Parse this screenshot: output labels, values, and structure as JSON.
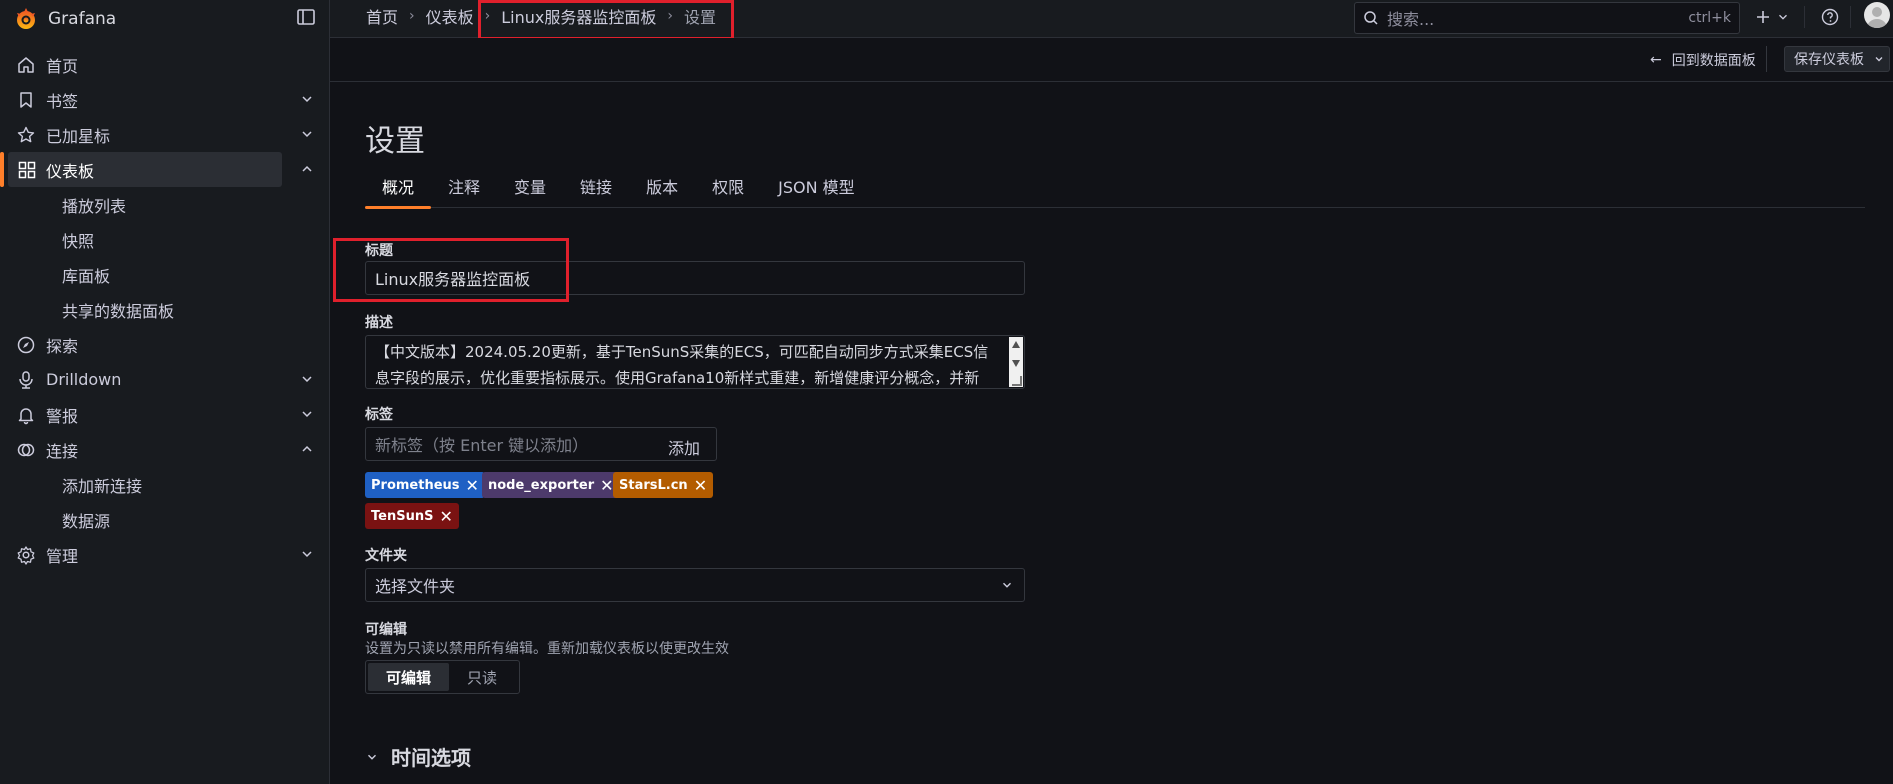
{
  "app": {
    "name": "Grafana",
    "accent": "#ff7f2a"
  },
  "sidebar": {
    "items": [
      {
        "label": "首页",
        "icon": "home-icon"
      },
      {
        "label": "书签",
        "icon": "bookmark-icon"
      },
      {
        "label": "已加星标",
        "icon": "star-icon"
      },
      {
        "label": "仪表板",
        "icon": "dashboard-grid-icon"
      },
      {
        "label": "播放列表"
      },
      {
        "label": "快照"
      },
      {
        "label": "库面板"
      },
      {
        "label": "共享的数据面板"
      },
      {
        "label": "探索",
        "icon": "compass-icon"
      },
      {
        "label": "Drilldown",
        "icon": "drilldown-icon"
      },
      {
        "label": "警报",
        "icon": "bell-icon"
      },
      {
        "label": "连接",
        "icon": "connections-icon"
      },
      {
        "label": "添加新连接"
      },
      {
        "label": "数据源"
      },
      {
        "label": "管理",
        "icon": "gear-icon"
      }
    ]
  },
  "breadcrumb": {
    "items": [
      "首页",
      "仪表板",
      "Linux服务器监控面板",
      "设置"
    ]
  },
  "search": {
    "placeholder": "搜索...",
    "shortcut": "ctrl+k"
  },
  "toolbar": {
    "back_label": "回到数据面板",
    "save_label": "保存仪表板"
  },
  "page": {
    "title": "设置",
    "tabs": [
      "概况",
      "注释",
      "变量",
      "链接",
      "版本",
      "权限",
      "JSON 模型"
    ]
  },
  "form": {
    "title_label": "标题",
    "title_value": "Linux服务器监控面板",
    "description_label": "描述",
    "description_value": "【中文版本】2024.05.20更新，基于TenSunS采集的ECS，可匹配自动同步方式采集ECS信息字段的展示，优化重要指标展示。使用Grafana10新样式重建，新增健康评分概念，并新",
    "tags_label": "标签",
    "tags_placeholder": "新标签（按 Enter 键以添加）",
    "tags_add": "添加",
    "tags": [
      {
        "name": "Prometheus",
        "color": "#1f60c4"
      },
      {
        "name": "node_exporter",
        "color": "#4d3a6b"
      },
      {
        "name": "StarsL.cn",
        "color": "#b35c00"
      },
      {
        "name": "TenSunS",
        "color": "#7a1212"
      }
    ],
    "folder_label": "文件夹",
    "folder_placeholder": "选择文件夹",
    "editable_label": "可编辑",
    "editable_desc": "设置为只读以禁用所有编辑。重新加载仪表板以使更改生效",
    "editable_options": [
      "可编辑",
      "只读"
    ],
    "editable_selected": "可编辑"
  },
  "section": {
    "time_options": "时间选项"
  }
}
